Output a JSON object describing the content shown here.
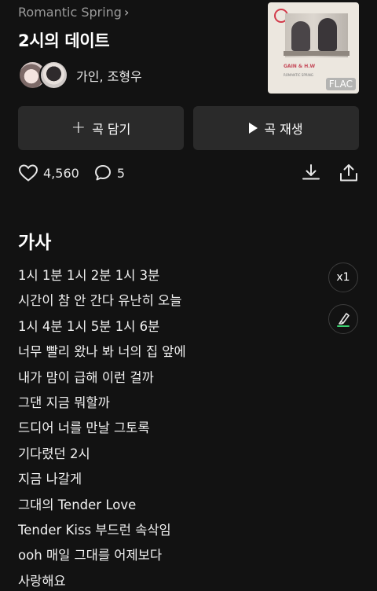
{
  "header": {
    "album_name": "Romantic Spring",
    "song_title": "2시의 데이트",
    "artists": "가인, 조형우",
    "cover_badge": "FLAC",
    "cover_artist_text": "GAIN & H.W",
    "cover_album_text": "ROMANTIC SPRING"
  },
  "actions": {
    "add_label": "곡 담기",
    "play_label": "곡 재생"
  },
  "stats": {
    "likes": "4,560",
    "comments": "5"
  },
  "lyrics": {
    "title": "가사",
    "speed_label": "x1",
    "lines": [
      "1시 1분 1시 2분 1시 3분",
      "시간이 참 안 간다 유난히 오늘",
      "1시 4분 1시 5분 1시 6분",
      "너무 빨리 왔나 봐 너의 집 앞에",
      "내가 맘이 급해 이런 걸까",
      "그댄 지금 뭐할까",
      "드디어 너를 만날 그토록",
      "기다렸던 2시",
      "지금 나갈게",
      "그대의 Tender Love",
      "Tender Kiss 부드런 속삭임",
      "ooh 매일 그대를 어제보다",
      "사랑해요"
    ]
  },
  "colors": {
    "background": "#121212",
    "button": "#2a2a2a",
    "highlight_accent": "#3bd16f"
  }
}
